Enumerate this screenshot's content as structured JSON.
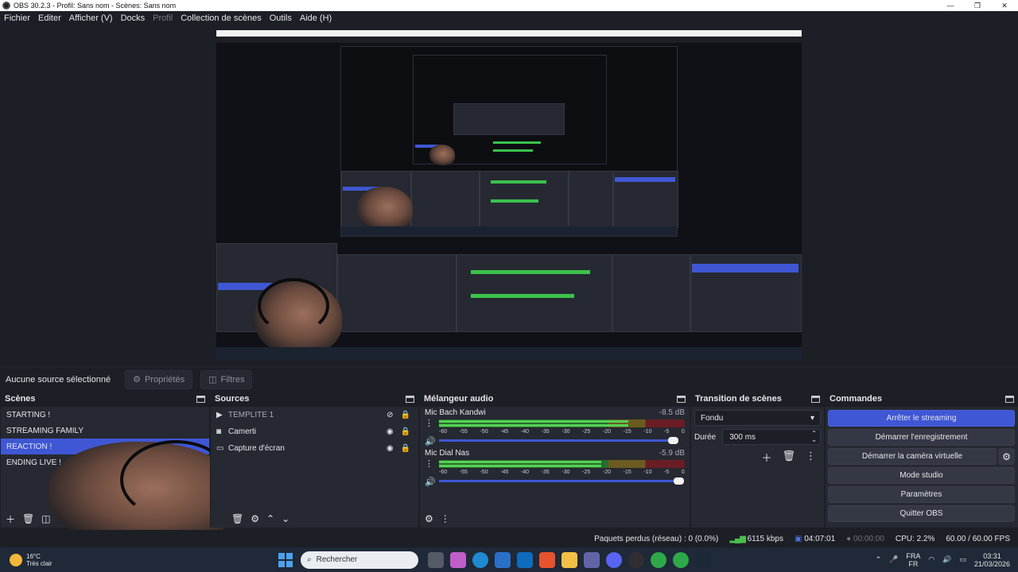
{
  "window": {
    "title": "OBS 30.2.3 - Profil: Sans nom - Scènes: Sans nom"
  },
  "menu": [
    "Fichier",
    "Editer",
    "Afficher (V)",
    "Docks",
    "Profil",
    "Collection de scènes",
    "Outils",
    "Aide (H)"
  ],
  "status_strip": {
    "no_source": "Aucune source sélectionné",
    "properties": "Propriétés",
    "filters": "Filtres"
  },
  "scenes": {
    "title": "Scènes",
    "items": [
      "STARTING !",
      "STREAMING FAMILY",
      "REACTION !",
      "ENDING LIVE !"
    ],
    "selected_index": 2
  },
  "sources": {
    "title": "Sources",
    "items": [
      {
        "name": "TEMPLITE 1",
        "icon": "play-icon"
      },
      {
        "name": "Camerti",
        "icon": "camera-icon"
      },
      {
        "name": "Capture d'écran",
        "icon": "display-icon"
      }
    ]
  },
  "mixer": {
    "title": "Mélangeur audio",
    "ticks": [
      "-60",
      "-55",
      "-50",
      "-45",
      "-40",
      "-35",
      "-30",
      "-25",
      "-20",
      "-15",
      "-10",
      "-5",
      "0"
    ],
    "channels": [
      {
        "name": "Mic Bach Kandwi",
        "db": "-8.5 dB",
        "level": 0.77,
        "volume": 0.87
      },
      {
        "name": "Mic Dial Nas",
        "db": "-5.9 dB",
        "level": 0.66,
        "volume": 0.89
      }
    ]
  },
  "transitions": {
    "title": "Transition de scènes",
    "selected": "Fondu",
    "duration_label": "Durée",
    "duration_value": "300 ms"
  },
  "commands": {
    "title": "Commandes",
    "stop_stream": "Arrêter le streaming",
    "start_record": "Démarrer l'enregistrement",
    "start_vcam": "Démarrer la caméra virtuelle",
    "studio_mode": "Mode studio",
    "settings": "Paramètres",
    "quit": "Quitter OBS"
  },
  "status_bar": {
    "dropped": "Paquets perdus (réseau) : 0 (0.0%)",
    "bitrate": "6115 kbps",
    "live_time": "04:07:01",
    "rec_time": "00:00:00",
    "cpu": "CPU: 2.2%",
    "fps": "60.00 / 60.00 FPS"
  },
  "taskbar": {
    "temp": "16°C",
    "weather": "Très clair",
    "search_placeholder": "Rechercher",
    "lang_top": "FRA",
    "lang_bottom": "FR",
    "time": "03:31",
    "date": "21/03/2026"
  },
  "colors": {
    "accent": "#3f57d4",
    "panel": "#262932",
    "bg": "#1d1f26",
    "meter_green": "#55d155"
  }
}
